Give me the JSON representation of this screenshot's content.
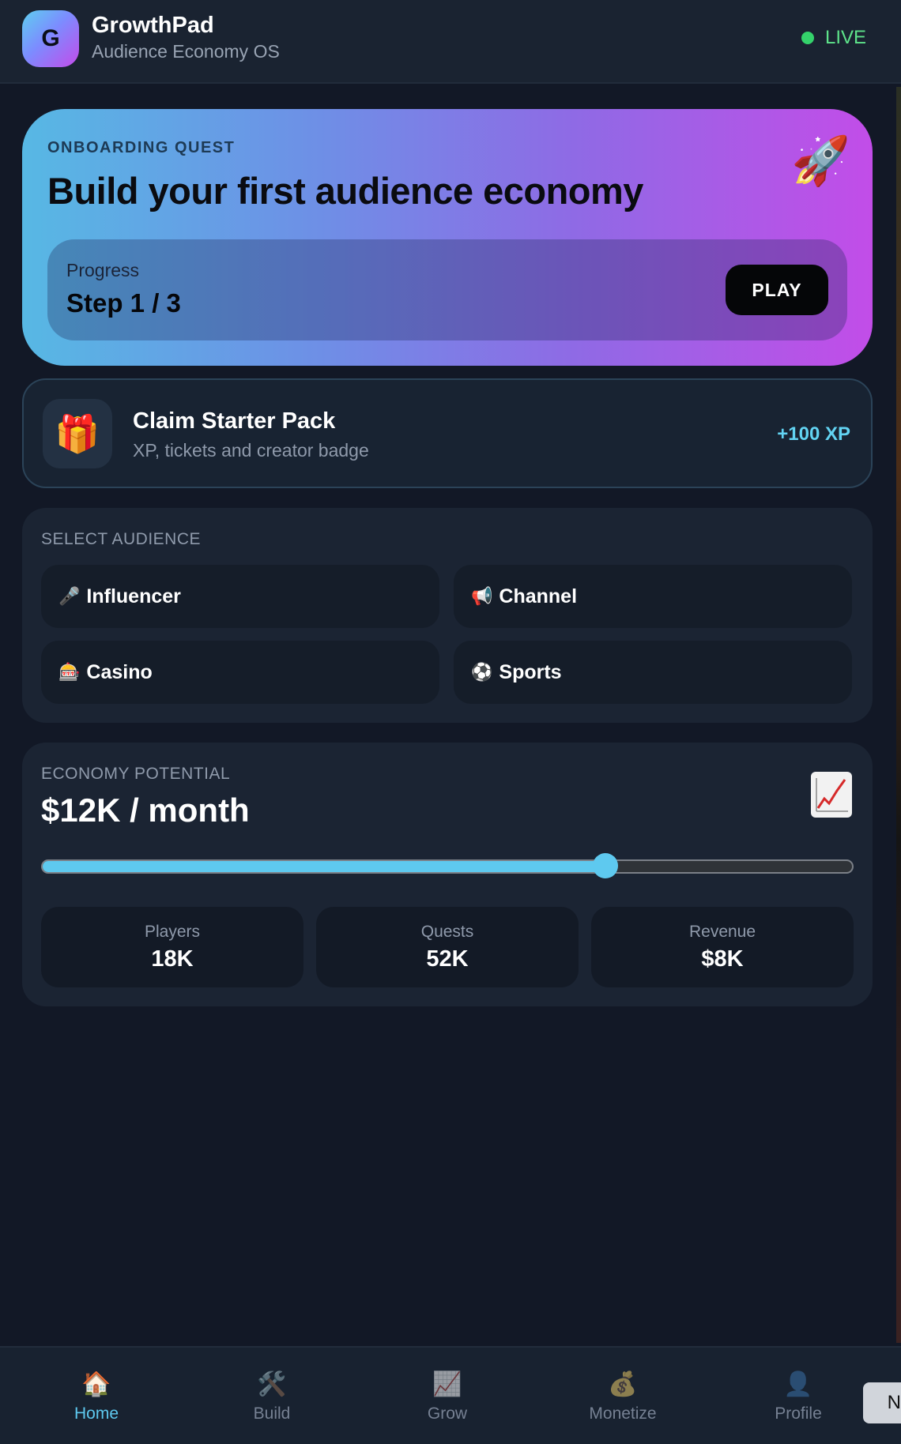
{
  "header": {
    "logo_letter": "G",
    "app_name": "GrowthPad",
    "app_subtitle": "Audience Economy OS",
    "status": "LIVE",
    "status_color": "#34d26b"
  },
  "hero": {
    "kicker": "ONBOARDING QUEST",
    "title": "Build your first audience economy",
    "icon": "rocket-icon",
    "icon_glyph": "🚀",
    "progress_label": "Progress",
    "progress_value": "Step 1 / 3",
    "play_label": "PLAY"
  },
  "starter_pack": {
    "icon": "gift-icon",
    "icon_glyph": "🎁",
    "title": "Claim Starter Pack",
    "subtitle": "XP, tickets and creator badge",
    "reward": "+100 XP"
  },
  "audience": {
    "label": "SELECT AUDIENCE",
    "options": [
      {
        "glyph": "🎤",
        "icon": "microphone-icon",
        "label": "Influencer"
      },
      {
        "glyph": "📢",
        "icon": "megaphone-icon",
        "label": "Channel"
      },
      {
        "glyph": "🎰",
        "icon": "slot-machine-icon",
        "label": "Casino"
      },
      {
        "glyph": "⚽",
        "icon": "soccer-ball-icon",
        "label": "Sports"
      }
    ]
  },
  "economy": {
    "label": "ECONOMY POTENTIAL",
    "value": "$12K / month",
    "icon": "chart-increasing-icon",
    "slider_value": 0.695,
    "accent": "#5ec9ef",
    "stats": [
      {
        "label": "Players",
        "value": "18K"
      },
      {
        "label": "Quests",
        "value": "52K"
      },
      {
        "label": "Revenue",
        "value": "$8K"
      }
    ]
  },
  "nav": {
    "items": [
      {
        "glyph": "🏠",
        "icon": "home-icon",
        "label": "Home",
        "active": true
      },
      {
        "glyph": "🛠️",
        "icon": "tools-icon",
        "label": "Build",
        "active": false
      },
      {
        "glyph": "📈",
        "icon": "chart-icon",
        "label": "Grow",
        "active": false
      },
      {
        "glyph": "💰",
        "icon": "money-bag-icon",
        "label": "Monetize",
        "active": false
      },
      {
        "glyph": "👤",
        "icon": "profile-icon",
        "label": "Profile",
        "active": false
      }
    ]
  },
  "edge_button_label": "N"
}
